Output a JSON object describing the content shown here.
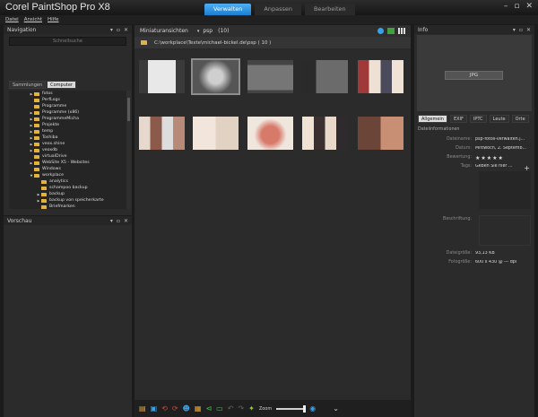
{
  "app": {
    "title": "Corel PaintShop Pro X8"
  },
  "mode_tabs": [
    "Verwalten",
    "Anpassen",
    "Bearbeiten"
  ],
  "menu": [
    "Datei",
    "Ansicht",
    "Hilfe"
  ],
  "navigation": {
    "title": "Navigation",
    "search_placeholder": "Schnellsuche",
    "tabs": [
      "Sammlungen",
      "Computer"
    ],
    "tree": [
      {
        "label": "fotos",
        "depth": 1,
        "arrow": true
      },
      {
        "label": "PerfLogs",
        "depth": 1,
        "arrow": false
      },
      {
        "label": "Programme",
        "depth": 1,
        "arrow": false
      },
      {
        "label": "Programme (x86)",
        "depth": 1,
        "arrow": true
      },
      {
        "label": "ProgrammeMicha",
        "depth": 1,
        "arrow": true
      },
      {
        "label": "Projekte",
        "depth": 1,
        "arrow": true
      },
      {
        "label": "temp",
        "depth": 1,
        "arrow": true
      },
      {
        "label": "Toshiba",
        "depth": 1,
        "arrow": true
      },
      {
        "label": "veox.shine",
        "depth": 1,
        "arrow": true
      },
      {
        "label": "veoxdb",
        "depth": 1,
        "arrow": true
      },
      {
        "label": "virtualDrive",
        "depth": 1,
        "arrow": false
      },
      {
        "label": "WebSite X5 - Websites",
        "depth": 1,
        "arrow": true
      },
      {
        "label": "Windows",
        "depth": 1,
        "arrow": false
      },
      {
        "label": "workplace",
        "depth": 1,
        "arrow": true,
        "open": true
      },
      {
        "label": "analytics",
        "depth": 2,
        "arrow": false
      },
      {
        "label": "schampoo backup",
        "depth": 2,
        "arrow": false
      },
      {
        "label": "backup",
        "depth": 2,
        "arrow": true
      },
      {
        "label": "backup von speicherkarte",
        "depth": 2,
        "arrow": true
      },
      {
        "label": "Briefmarken",
        "depth": 2,
        "arrow": false
      }
    ]
  },
  "preview": {
    "title": "Vorschau"
  },
  "center": {
    "title": "Miniaturansichten",
    "filter": "psp",
    "count": "(10)",
    "path": "C:\\workplace\\Texte\\michael-bickel.de\\psp ( 10 )",
    "zoom_label": "Zoom"
  },
  "info": {
    "title": "Info",
    "badge": "JPG",
    "tabs": [
      "Allgemein",
      "EXIF",
      "IPTC",
      "Leute",
      "Orte"
    ],
    "section_title": "Dateiinformationen",
    "fields": [
      {
        "k": "Dateiname:",
        "v": "psp-fotos-verwalten.j..."
      },
      {
        "k": "Datum:",
        "v": "Mittwoch, 2. Septemb..."
      },
      {
        "k": "Bewertung:",
        "v": "★★★★★"
      },
      {
        "k": "Tags:",
        "v": "Geben Sie hier ..."
      }
    ],
    "caption_label": "Beschriftung:",
    "size": {
      "k": "Dateigröße:",
      "v": "93,13 KB"
    },
    "dims": {
      "k": "Fotogröße:",
      "v": "600 x 430 @ --- dpi"
    }
  },
  "colors": {
    "accent": "#2d92e6",
    "folder": "#e3b33b"
  }
}
